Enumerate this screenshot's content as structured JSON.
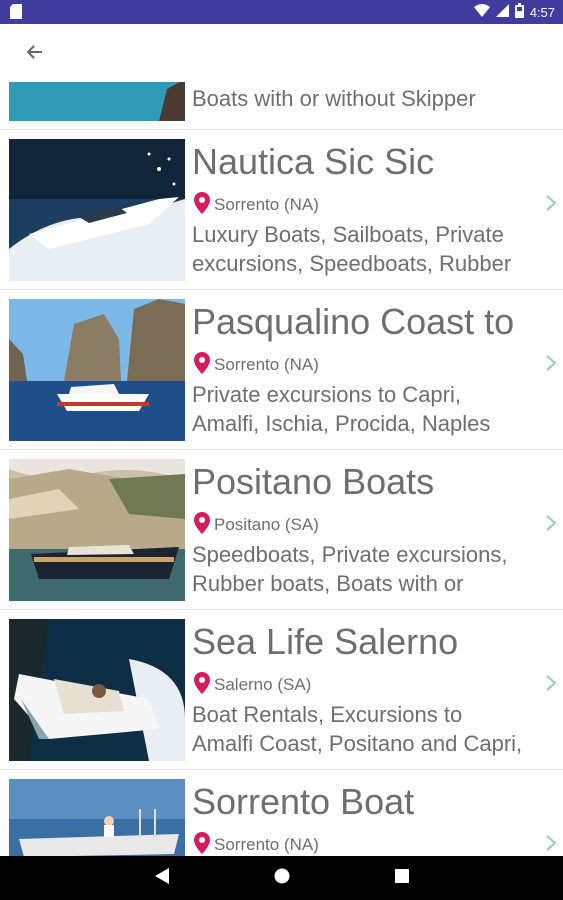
{
  "status_bar": {
    "time": "4:57"
  },
  "colors": {
    "status_bar": "#3f3c9e",
    "pin": "#d81b60",
    "chevron": "#8bd3a3",
    "text": "#6e6e6e"
  },
  "top_partial": {
    "desc": "Boats with or without Skipper"
  },
  "listings": [
    {
      "title": "Nautica Sic Sic",
      "location": "Sorrento (NA)",
      "desc_line1": "Luxury Boats, Sailboats, Private",
      "desc_line2": "excursions, Speedboats, Rubber"
    },
    {
      "title": "Pasqualino Coast to",
      "location": "Sorrento (NA)",
      "desc_line1": "Private excursions to Capri,",
      "desc_line2": "Amalfi, Ischia, Procida, Naples"
    },
    {
      "title": "Positano Boats",
      "location": "Positano (SA)",
      "desc_line1": "Speedboats, Private excursions,",
      "desc_line2": "Rubber boats, Boats with or"
    },
    {
      "title": "Sea Life Salerno",
      "location": "Salerno (SA)",
      "desc_line1": "Boat Rentals, Excursions to",
      "desc_line2": "Amalfi Coast, Positano and Capri,"
    },
    {
      "title": "Sorrento Boat",
      "location": "Sorrento (NA)",
      "desc_line1": "",
      "desc_line2": ""
    }
  ]
}
